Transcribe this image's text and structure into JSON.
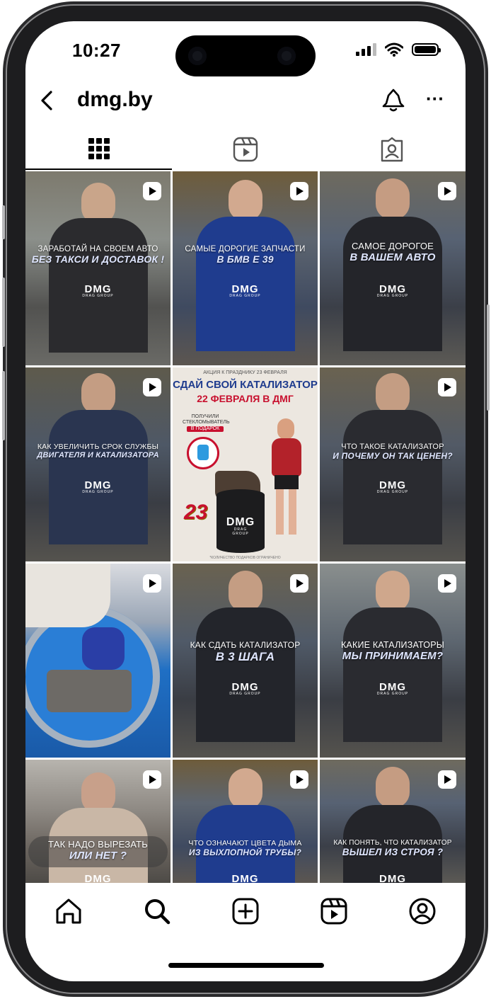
{
  "status": {
    "time": "10:27"
  },
  "header": {
    "title": "dmg.by",
    "back_icon": "chevron-left-icon",
    "bell_icon": "bell-icon",
    "more_label": "···"
  },
  "tabs": [
    {
      "name": "grid",
      "icon": "grid-icon",
      "active": true
    },
    {
      "name": "reels",
      "icon": "reels-icon",
      "active": false
    },
    {
      "name": "tagged",
      "icon": "tagged-icon",
      "active": false
    }
  ],
  "posts": [
    {
      "line1": "ЗАРАБОТАЙ НА СВОЕМ АВТО",
      "line2": "БЕЗ ТАКСИ И ДОСТАВОК !",
      "logo": "DMG",
      "logo_sub": "DRAG GROUP"
    },
    {
      "line1": "САМЫЕ ДОРОГИЕ ЗАПЧАСТИ",
      "line2": "В БМВ Е 39",
      "logo": "DMG",
      "logo_sub": "DRAG GROUP"
    },
    {
      "line1": "САМОЕ ДОРОГОЕ",
      "line2": "В ВАШЕМ АВТО",
      "logo": "DMG",
      "logo_sub": "DRAG GROUP"
    },
    {
      "line1": "КАК УВЕЛИЧИТЬ СРОК СЛУЖБЫ",
      "line2": "ДВИГАТЕЛЯ И КАТАЛИЗАТОРА",
      "logo": "DMG",
      "logo_sub": "DRAG GROUP"
    },
    {
      "promo": true,
      "top": "АКЦИЯ К ПРАЗДНИКУ 23 ФЕВРАЛЯ",
      "line1": "СДАЙ СВОЙ КАТАЛИЗАТОР",
      "line2": "22 ФЕВРАЛЯ В ДМГ",
      "gift1": "ПОЛУЧИЛИ",
      "gift2": "СТЕКЛОМЫВАТЕЛЬ",
      "gift3": "В ПОДАРОК",
      "badge": "23",
      "logo": "DMG",
      "logo_sub": "DRAG GROUP",
      "footnote": "*КОЛИЧЕСТВО ПОДАРКОВ ОГРАНИЧЕНО"
    },
    {
      "line1": "ЧТО ТАКОЕ КАТАЛИЗАТОР",
      "line2": "И ПОЧЕМУ ОН ТАК ЦЕНЕН?",
      "logo": "DMG",
      "logo_sub": "DRAG GROUP"
    },
    {
      "line1": "",
      "line2": "",
      "logo": "",
      "logo_sub": ""
    },
    {
      "line1": "КАК СДАТЬ КАТАЛИЗАТОР",
      "line2": "В 3 ШАГА",
      "logo": "DMG",
      "logo_sub": "DRAG GROUP"
    },
    {
      "line1": "КАКИЕ КАТАЛИЗАТОРЫ",
      "line2": "МЫ ПРИНИМАЕМ?",
      "logo": "DMG",
      "logo_sub": "DRAG GROUP"
    },
    {
      "line1": "ТАК НАДО ВЫРЕЗАТЬ",
      "line2": "ИЛИ НЕТ ?",
      "logo": "DMG",
      "logo_sub": ""
    },
    {
      "line1": "ЧТО ОЗНАЧАЮТ ЦВЕТА ДЫМА",
      "line2": "ИЗ ВЫХЛОПНОЙ ТРУБЫ?",
      "logo": "DMG",
      "logo_sub": ""
    },
    {
      "line1": "КАК ПОНЯТЬ, ЧТО КАТАЛИЗАТОР",
      "line2": "ВЫШЕЛ ИЗ СТРОЯ ?",
      "logo": "DMG",
      "logo_sub": ""
    }
  ],
  "bottom_nav": [
    {
      "name": "home",
      "icon": "home-icon"
    },
    {
      "name": "search",
      "icon": "search-icon"
    },
    {
      "name": "create",
      "icon": "plus-square-icon"
    },
    {
      "name": "reels",
      "icon": "reels-icon"
    },
    {
      "name": "profile",
      "icon": "profile-icon"
    }
  ],
  "colors": {
    "accent_blue": "#1f3c8e",
    "caption_blue": "#dfe6ff",
    "frame": "#1d1d1f"
  }
}
